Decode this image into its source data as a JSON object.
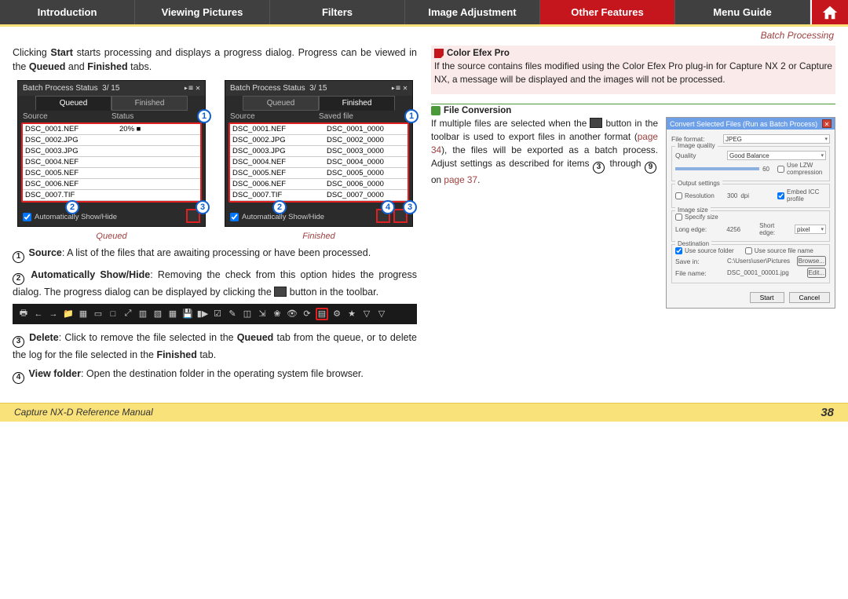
{
  "nav": {
    "tabs": [
      "Introduction",
      "Viewing Pictures",
      "Filters",
      "Image Adjustment",
      "Other Features",
      "Menu Guide"
    ],
    "activeIndex": 4
  },
  "crumb": "Batch Processing",
  "left": {
    "intro_a": "Clicking ",
    "intro_b": "Start",
    "intro_c": " starts processing and displays a progress dialog. Progress can be viewed in the ",
    "intro_d": "Queued",
    "intro_e": " and ",
    "intro_f": "Finished",
    "intro_g": " tabs.",
    "dlg": {
      "title": "Batch Process Status",
      "count": "3/  15",
      "tab_q": "Queued",
      "tab_f": "Finished",
      "hdr_src": "Source",
      "hdr_status": "Status",
      "hdr_saved": "Saved file",
      "autoshow": "Automatically Show/Hide",
      "rows_q": [
        {
          "a": "DSC_0001.NEF",
          "b": "20% ■"
        },
        {
          "a": "DSC_0002.JPG",
          "b": ""
        },
        {
          "a": "DSC_0003.JPG",
          "b": ""
        },
        {
          "a": "DSC_0004.NEF",
          "b": ""
        },
        {
          "a": "DSC_0005.NEF",
          "b": ""
        },
        {
          "a": "DSC_0006.NEF",
          "b": ""
        },
        {
          "a": "DSC_0007.TIF",
          "b": ""
        }
      ],
      "rows_f": [
        {
          "a": "DSC_0001.NEF",
          "b": "DSC_0001_0000"
        },
        {
          "a": "DSC_0002.JPG",
          "b": "DSC_0002_0000"
        },
        {
          "a": "DSC_0003.JPG",
          "b": "DSC_0003_0000"
        },
        {
          "a": "DSC_0004.NEF",
          "b": "DSC_0004_0000"
        },
        {
          "a": "DSC_0005.NEF",
          "b": "DSC_0005_0000"
        },
        {
          "a": "DSC_0006.NEF",
          "b": "DSC_0006_0000"
        },
        {
          "a": "DSC_0007.TIF",
          "b": "DSC_0007_0000"
        }
      ],
      "cap_q": "Queued",
      "cap_f": "Finished"
    },
    "items": {
      "n1a": "Source",
      "n1b": ": A list of the files that are awaiting processing or have been processed.",
      "n2a": "Automatically Show/Hide",
      "n2b": ": Removing the check from this option hides the prog­ress dialog. The progress dialog can be displayed by clicking the ",
      "n2c": " button in the toolbar.",
      "n3a": "Delete",
      "n3b": ": Click to remove the file selected in the ",
      "n3c": "Queued",
      "n3d": " tab from the queue, or to delete the log for the file selected in the ",
      "n3e": "Finished",
      "n3f": " tab.",
      "n4a": "View folder",
      "n4b": ": Open the destination folder in the operating system file browser."
    }
  },
  "right": {
    "cep_title": "Color Efex Pro",
    "cep_body": "If the source contains files modified using the Color Efex Pro plug-in for Capture NX 2 or Capture NX, a message will be displayed and the images will not be processed.",
    "fc_title": "File Conversion",
    "fc_a": "If multiple files are selected when the ",
    "fc_b": " button in the toolbar is used to export files in another format (",
    "fc_link1": "page 34",
    "fc_c": "), the files will be exported as a batch process. Adjust settings as described for items ",
    "fc_d": " through ",
    "fc_e": " on ",
    "fc_link2": "page 37",
    "fc_f": ".",
    "conv": {
      "title": "Convert Selected Files (Run as Batch Process)",
      "file_format_lbl": "File format:",
      "file_format_val": "JPEG",
      "iq": "Image quality",
      "quality_lbl": "Quality",
      "quality_val": "Good Balance",
      "quality_num": "60",
      "lzw": "Use LZW compression",
      "out": "Output settings",
      "res_lbl": "Resolution",
      "res_val": "300",
      "res_unit": "dpi",
      "icc": "Embed ICC profile",
      "size": "Image size",
      "spec": "Specify size",
      "le_lbl": "Long edge:",
      "le_val": "4256",
      "se_lbl": "Short edge:",
      "unit": "pixel",
      "dest": "Destination",
      "use_src": "Use source folder",
      "use_name": "Use source file name",
      "save_lbl": "Save in:",
      "save_val": "C:\\Users\\user\\Pictures",
      "browse": "Browse...",
      "fname_lbl": "File name:",
      "fname_val": "DSC_0001_00001.jpg",
      "edit": "Edit...",
      "start": "Start",
      "cancel": "Cancel"
    }
  },
  "footer": {
    "manual": "Capture NX-D Reference Manual",
    "page": "38"
  },
  "callouts": {
    "c1": "1",
    "c2": "2",
    "c3": "3",
    "c4": "4",
    "c9": "9"
  }
}
